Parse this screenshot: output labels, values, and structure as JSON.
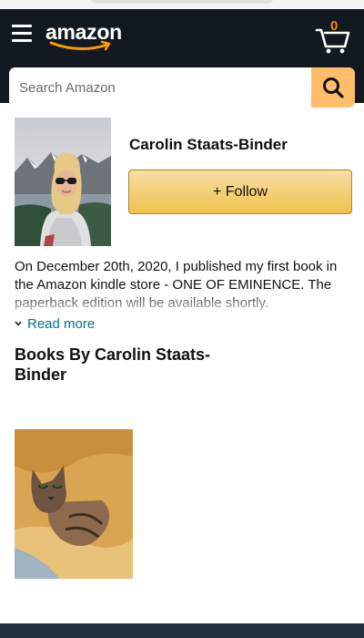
{
  "header": {
    "logo_text": "amazon",
    "cart_count": "0",
    "menu_icon": "hamburger-menu-icon",
    "cart_icon": "cart-icon",
    "bg_color": "#131921",
    "accent_color": "#febd69"
  },
  "search": {
    "placeholder": "Search Amazon",
    "icon": "search-icon"
  },
  "author": {
    "name": "Carolin Staats-Binder",
    "follow_label": "+ Follow",
    "bio": "On December 20th, 2020, I published my first book in the Amazon kindle store - ONE OF EMINENCE. The paperback edition will be available shortly.",
    "read_more_label": "Read more"
  },
  "books": {
    "heading": "Books By Carolin Staats-Binder"
  }
}
